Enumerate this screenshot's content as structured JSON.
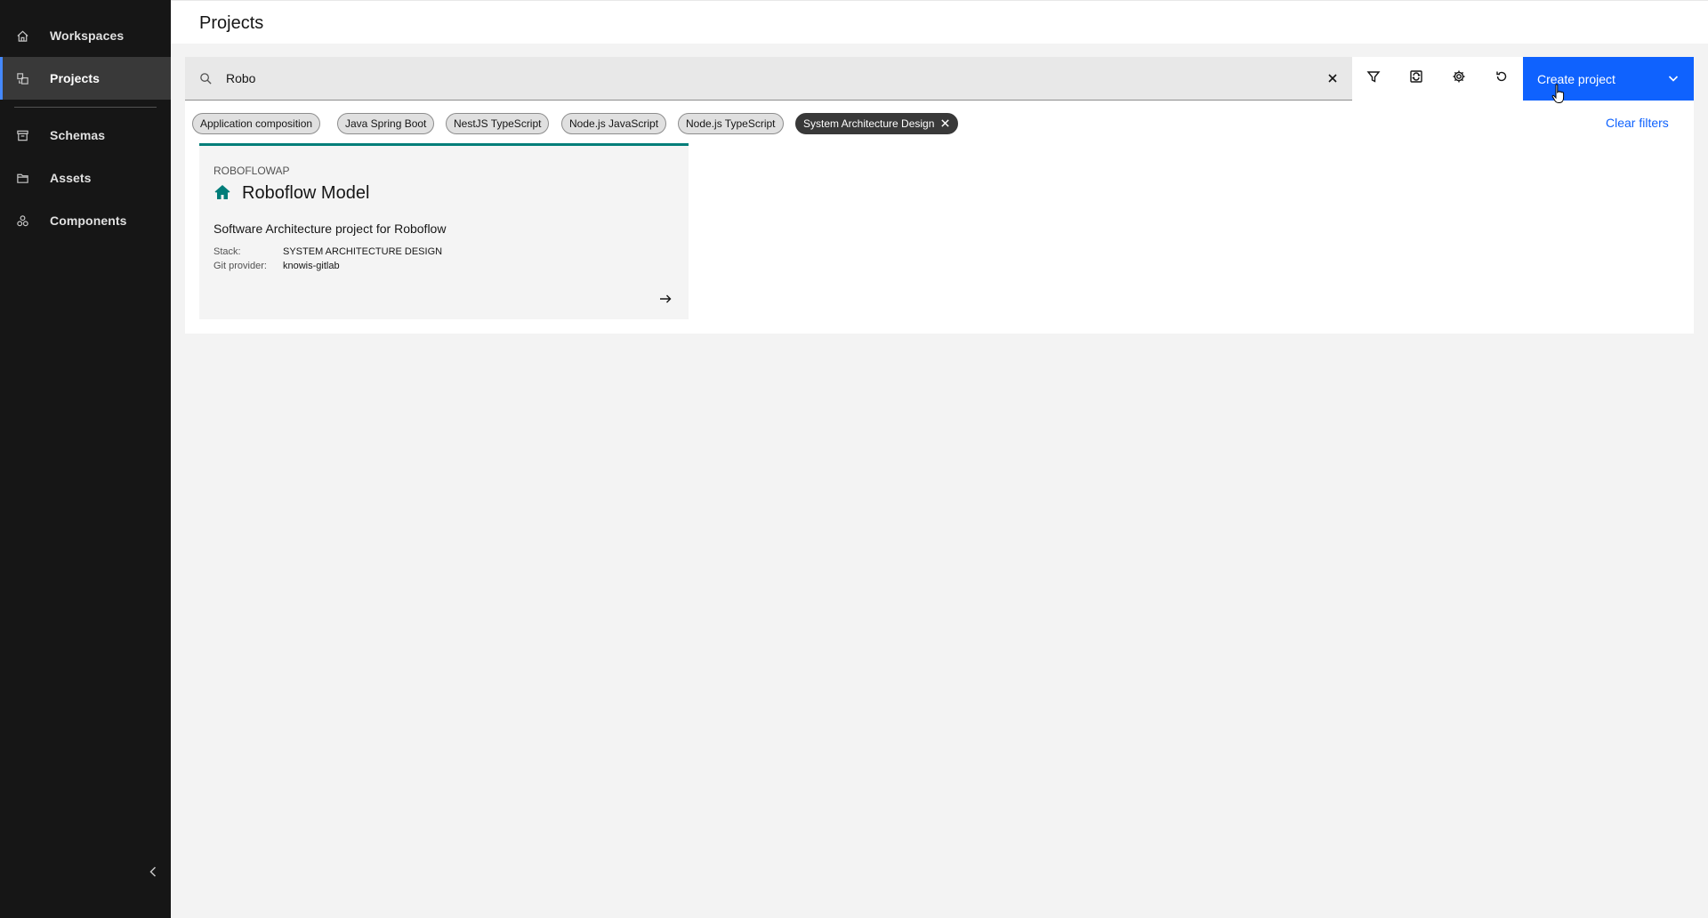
{
  "sidebar": {
    "items": [
      {
        "label": "Workspaces",
        "icon": "home-icon"
      },
      {
        "label": "Projects",
        "icon": "projects-icon",
        "active": true
      },
      {
        "label": "Schemas",
        "icon": "schemas-icon"
      },
      {
        "label": "Assets",
        "icon": "folder-icon"
      },
      {
        "label": "Components",
        "icon": "components-icon"
      }
    ],
    "collapse_icon": "chevron-left-icon"
  },
  "header": {
    "title": "Projects"
  },
  "search": {
    "value": "Robo",
    "icon": "search-icon",
    "clear_icon": "close-icon"
  },
  "toolbar": {
    "icons": [
      "filter-icon",
      "sync-icon",
      "settings-icon",
      "reset-icon"
    ],
    "create_label": "Create project",
    "create_icon": "chevron-down-icon",
    "accent_color": "#0f62fe"
  },
  "filters": {
    "tags": [
      {
        "label": "Application composition",
        "selected": false
      },
      {
        "label": "Java Spring Boot",
        "selected": false
      },
      {
        "label": "NestJS TypeScript",
        "selected": false
      },
      {
        "label": "Node.js JavaScript",
        "selected": false
      },
      {
        "label": "Node.js TypeScript",
        "selected": false
      },
      {
        "label": "System Architecture Design",
        "selected": true
      }
    ],
    "clear_label": "Clear filters"
  },
  "cards": [
    {
      "kicker": "ROBOFLOWAP",
      "title": "Roboflow Model",
      "icon": "home-icon",
      "description": "Software Architecture project for Roboflow",
      "stack_label": "Stack:",
      "stack_value": "SYSTEM ARCHITECTURE DESIGN",
      "git_label": "Git provider:",
      "git_value": "knowis-gitlab",
      "accent_color": "#007d79",
      "arrow_icon": "arrow-right-icon"
    }
  ]
}
